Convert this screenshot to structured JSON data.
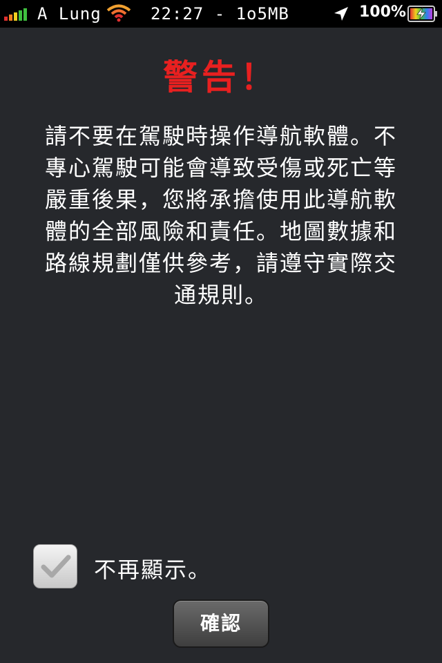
{
  "status_bar": {
    "carrier": "A Lung",
    "time_memory": "22:27 - 1o5MB",
    "battery_percent": "100%",
    "signal_bars": 5,
    "icons": [
      "signal-icon",
      "wifi-icon",
      "location-arrow-icon",
      "battery-charging-icon"
    ],
    "signal_colors": [
      "#e03030",
      "#f08020",
      "#f0d020",
      "#40c040",
      "#40c040"
    ]
  },
  "dialog": {
    "title": "警告！",
    "title_color": "#e82020",
    "message": "請不要在駕駛時操作導航軟體。不專心駕駛可能會導致受傷或死亡等嚴重後果，您將承擔使用此導航軟體的全部風險和責任。地圖數據和路線規劃僅供參考，請遵守實際交通規則。",
    "checkbox_label": "不再顯示。",
    "checkbox_checked": true,
    "confirm_label": "確認"
  },
  "colors": {
    "background": "#26282c",
    "status_bar": "#000000"
  }
}
